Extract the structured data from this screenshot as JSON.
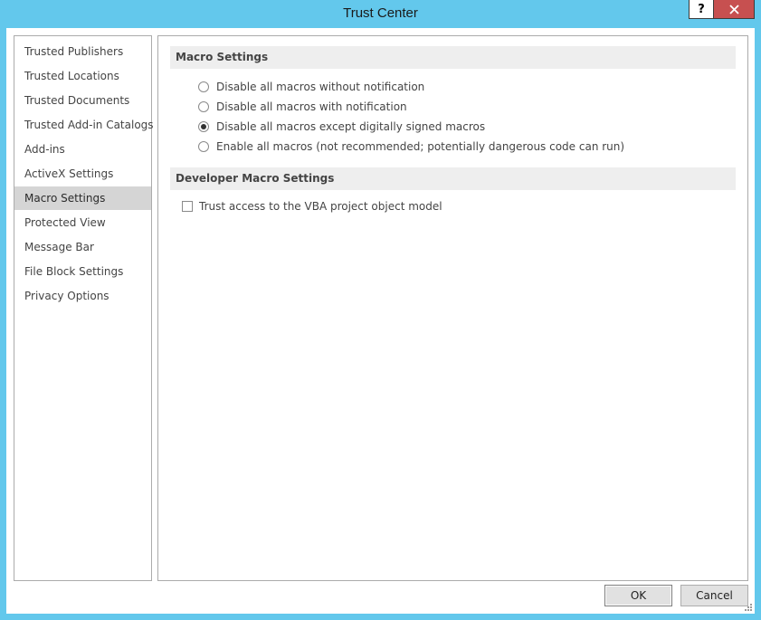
{
  "window": {
    "title": "Trust Center",
    "help_label": "?",
    "accent_color": "#63c8ec",
    "close_color": "#c75050"
  },
  "sidebar": {
    "items": [
      {
        "label": "Trusted Publishers",
        "selected": false
      },
      {
        "label": "Trusted Locations",
        "selected": false
      },
      {
        "label": "Trusted Documents",
        "selected": false
      },
      {
        "label": "Trusted Add-in Catalogs",
        "selected": false
      },
      {
        "label": "Add-ins",
        "selected": false
      },
      {
        "label": "ActiveX Settings",
        "selected": false
      },
      {
        "label": "Macro Settings",
        "selected": true
      },
      {
        "label": "Protected View",
        "selected": false
      },
      {
        "label": "Message Bar",
        "selected": false
      },
      {
        "label": "File Block Settings",
        "selected": false
      },
      {
        "label": "Privacy Options",
        "selected": false
      }
    ]
  },
  "macro_settings": {
    "heading": "Macro Settings",
    "options": [
      {
        "label": "Disable all macros without notification",
        "checked": false
      },
      {
        "label": "Disable all macros with notification",
        "checked": false
      },
      {
        "label": "Disable all macros except digitally signed macros",
        "checked": true
      },
      {
        "label": "Enable all macros (not recommended; potentially dangerous code can run)",
        "checked": false
      }
    ]
  },
  "developer_settings": {
    "heading": "Developer Macro Settings",
    "trust_vba": {
      "label": "Trust access to the VBA project object model",
      "checked": false
    }
  },
  "buttons": {
    "ok_label": "OK",
    "cancel_label": "Cancel"
  }
}
